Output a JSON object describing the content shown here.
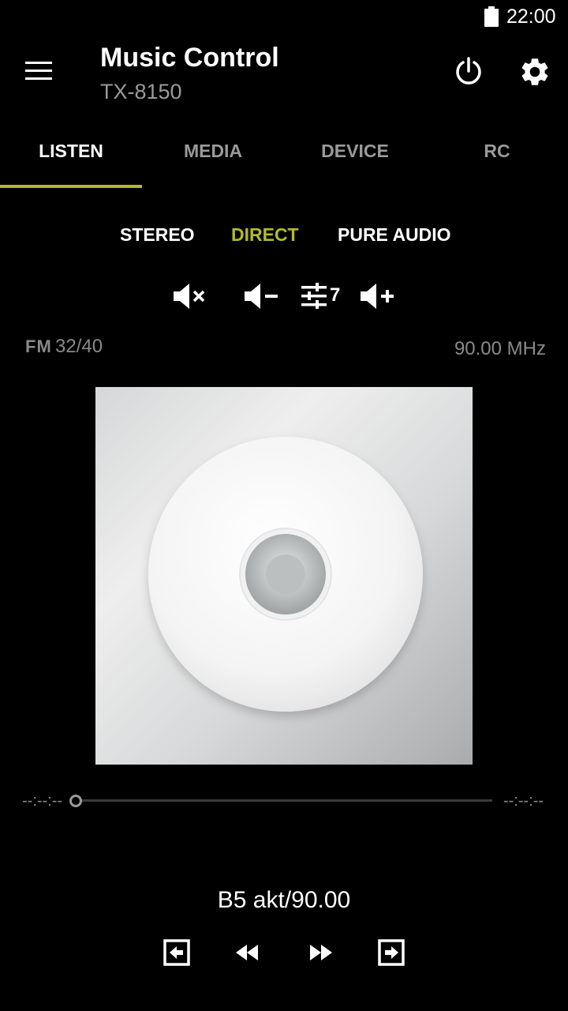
{
  "status_bar": {
    "time": "22:00",
    "icons": [
      "battery-full-icon"
    ]
  },
  "app_bar": {
    "title": "Music Control",
    "subtitle": "TX-8150",
    "icons": [
      "menu-icon",
      "power-icon",
      "settings-icon"
    ]
  },
  "tabs": [
    {
      "label": "LISTEN",
      "active": true
    },
    {
      "label": "MEDIA",
      "active": false
    },
    {
      "label": "DEVICE",
      "active": false
    },
    {
      "label": "RC",
      "active": false
    }
  ],
  "listening_modes": [
    {
      "label": "STEREO",
      "active": false
    },
    {
      "label": "DIRECT",
      "active": true
    },
    {
      "label": "PURE AUDIO",
      "active": false
    }
  ],
  "volume_controls": {
    "icons": [
      "mute-icon",
      "volume-down-icon",
      "equalizer-icon",
      "volume-up-icon"
    ],
    "eq_value": "7"
  },
  "tuner": {
    "band": "FM",
    "preset": "32/40",
    "frequency": "90.00 MHz"
  },
  "album_art": {
    "icon": "cd-disc-icon"
  },
  "seek": {
    "elapsed": "--:--:--",
    "remaining": "--:--:--",
    "progress": 0
  },
  "now_playing": {
    "title": "B5 akt/90.00"
  },
  "transport": {
    "icons": [
      "previous-preset-icon",
      "rewind-icon",
      "fast-forward-icon",
      "next-preset-icon"
    ]
  },
  "colors": {
    "accent": "#b3ba2a",
    "background": "#000000",
    "secondary_text": "#9a9a9a"
  }
}
